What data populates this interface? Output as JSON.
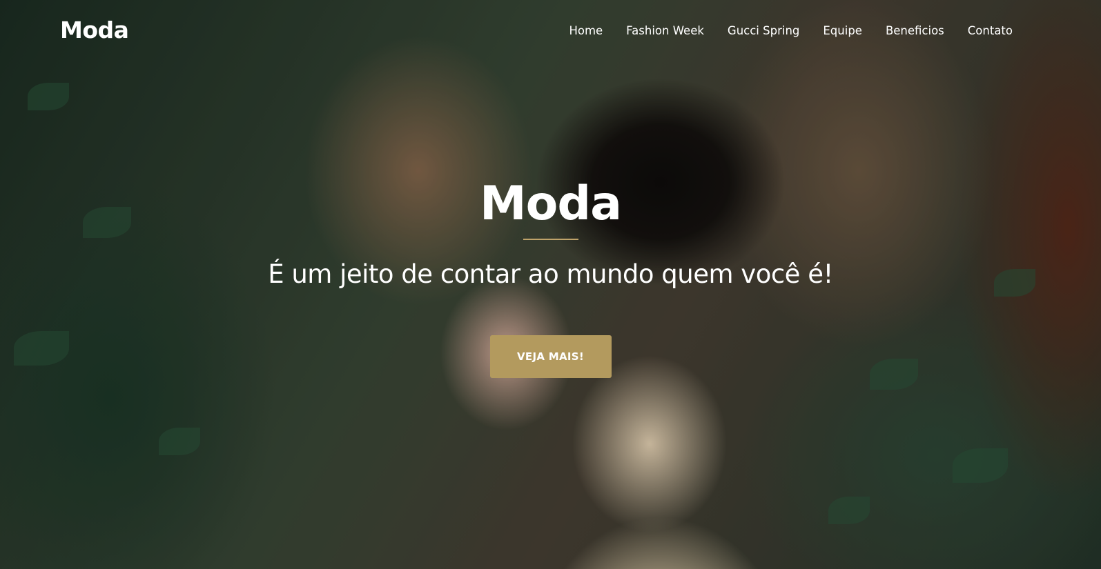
{
  "header": {
    "brand": "Moda",
    "nav": [
      "Home",
      "Fashion Week",
      "Gucci Spring",
      "Equipe",
      "Beneficios",
      "Contato"
    ]
  },
  "hero": {
    "title": "Moda",
    "subtitle": "É um jeito de contar ao mundo quem você é!",
    "cta_label": "VEJA MAIS!",
    "background_image": "photo-woman-black-hat-foliage"
  },
  "colors": {
    "accent": "#b39a5e",
    "text": "#ffffff"
  }
}
